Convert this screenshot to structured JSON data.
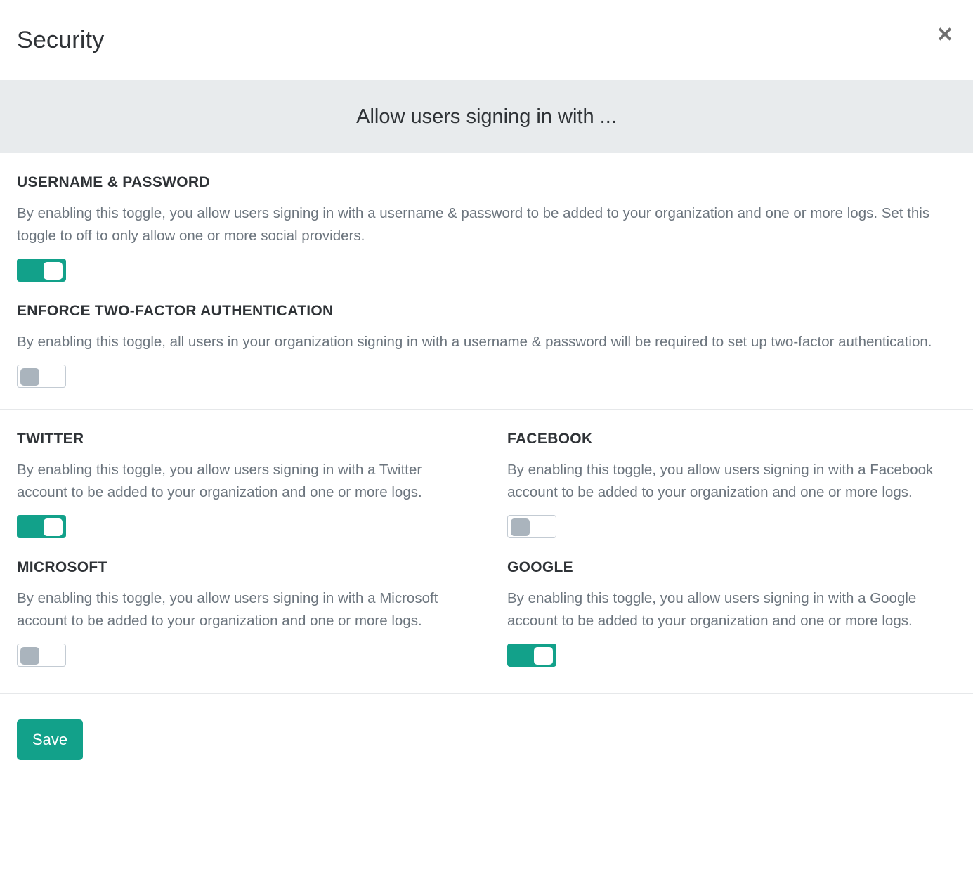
{
  "modal": {
    "title": "Security",
    "close_icon": "close-icon",
    "close_glyph": "✕"
  },
  "banner": {
    "text": "Allow users signing in with ..."
  },
  "colors": {
    "accent_teal": "#12a18a",
    "banner_bg": "#e8ebed",
    "body_text": "#6c757e",
    "label_text": "#2f3337",
    "toggle_off_knob": "#aab4bd",
    "toggle_off_border": "#c3cbd3",
    "divider": "#e6e8ea"
  },
  "primary_settings": [
    {
      "label": "USERNAME & PASSWORD",
      "description": "By enabling this toggle, you allow users signing in with a username & password to be added to your organization and one or more logs. Set this toggle to off to only allow one or more social providers.",
      "toggle_state": "on"
    },
    {
      "label": "ENFORCE TWO-FACTOR AUTHENTICATION",
      "description": "By enabling this toggle, all users in your organization signing in with a username & password will be required to set up two-factor authentication.",
      "toggle_state": "off"
    }
  ],
  "social_settings": [
    {
      "label": "TWITTER",
      "description": "By enabling this toggle, you allow users signing in with a Twitter account to be added to your organization and one or more logs.",
      "toggle_state": "on"
    },
    {
      "label": "FACEBOOK",
      "description": "By enabling this toggle, you allow users signing in with a Facebook account to be added to your organization and one or more logs.",
      "toggle_state": "off"
    },
    {
      "label": "MICROSOFT",
      "description": "By enabling this toggle, you allow users signing in with a Microsoft account to be added to your organization and one or more logs.",
      "toggle_state": "off"
    },
    {
      "label": "GOOGLE",
      "description": "By enabling this toggle, you allow users signing in with a Google account to be added to your organization and one or more logs.",
      "toggle_state": "on"
    }
  ],
  "footer": {
    "save_label": "Save"
  }
}
